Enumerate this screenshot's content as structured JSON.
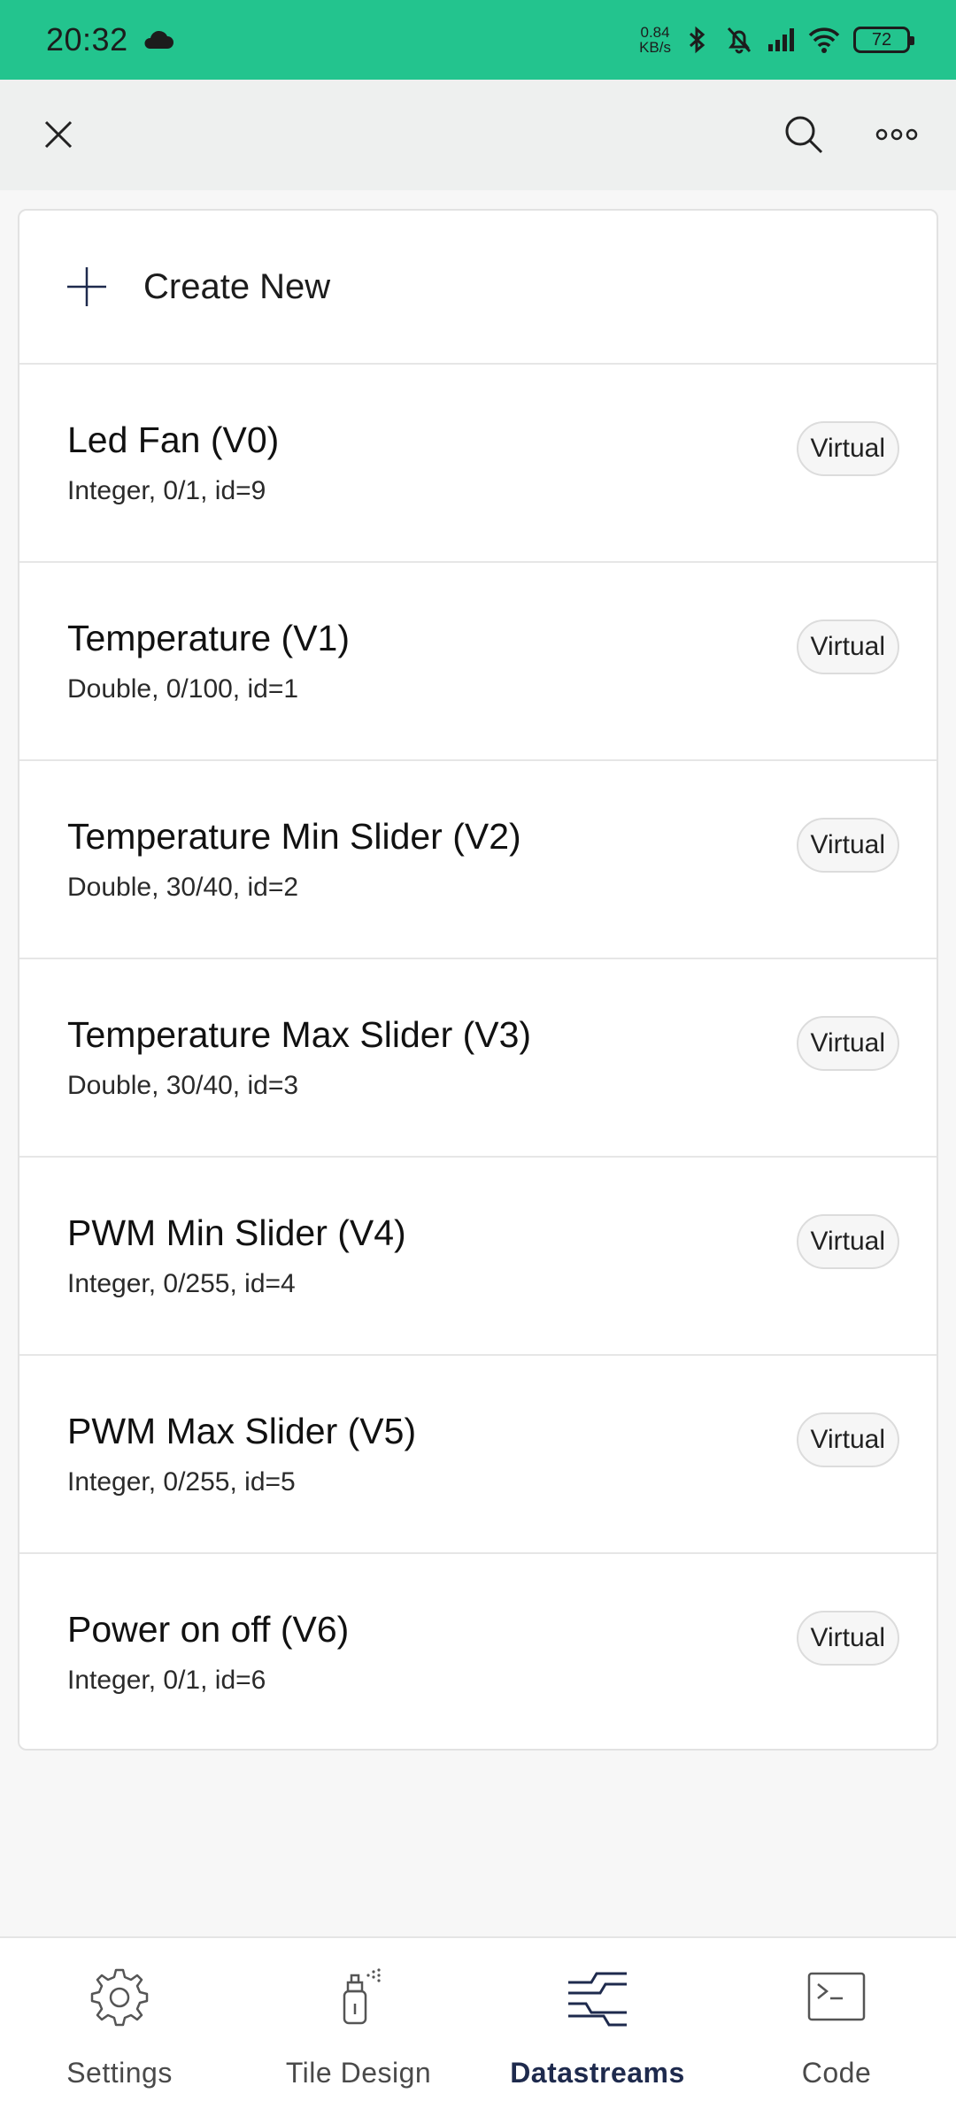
{
  "status_bar": {
    "time": "20:32",
    "net_speed_value": "0.84",
    "net_speed_unit": "KB/s",
    "battery": "72",
    "signal_sub": "6"
  },
  "colors": {
    "status_bar_bg": "#23c48e",
    "active_nav": "#1e2a4d"
  },
  "toolbar": {
    "icons": [
      "close-icon",
      "search-icon",
      "more-icon"
    ]
  },
  "create_new": {
    "label": "Create New"
  },
  "datastreams": [
    {
      "title": "Led Fan (V0)",
      "subtitle": "Integer, 0/1, id=9",
      "badge": "Virtual"
    },
    {
      "title": "Temperature (V1)",
      "subtitle": "Double, 0/100, id=1",
      "badge": "Virtual"
    },
    {
      "title": "Temperature Min Slider (V2)",
      "subtitle": "Double, 30/40, id=2",
      "badge": "Virtual"
    },
    {
      "title": "Temperature Max Slider (V3)",
      "subtitle": "Double, 30/40, id=3",
      "badge": "Virtual"
    },
    {
      "title": "PWM Min Slider (V4)",
      "subtitle": "Integer, 0/255, id=4",
      "badge": "Virtual"
    },
    {
      "title": "PWM Max Slider (V5)",
      "subtitle": "Integer, 0/255, id=5",
      "badge": "Virtual"
    },
    {
      "title": "Power on off (V6)",
      "subtitle": "Integer, 0/1, id=6",
      "badge": "Virtual"
    }
  ],
  "bottom_nav": {
    "items": [
      {
        "label": "Settings",
        "icon": "gear-icon",
        "active": false
      },
      {
        "label": "Tile Design",
        "icon": "spray-can-icon",
        "active": false
      },
      {
        "label": "Datastreams",
        "icon": "datastreams-icon",
        "active": true
      },
      {
        "label": "Code",
        "icon": "terminal-icon",
        "active": false
      }
    ]
  }
}
